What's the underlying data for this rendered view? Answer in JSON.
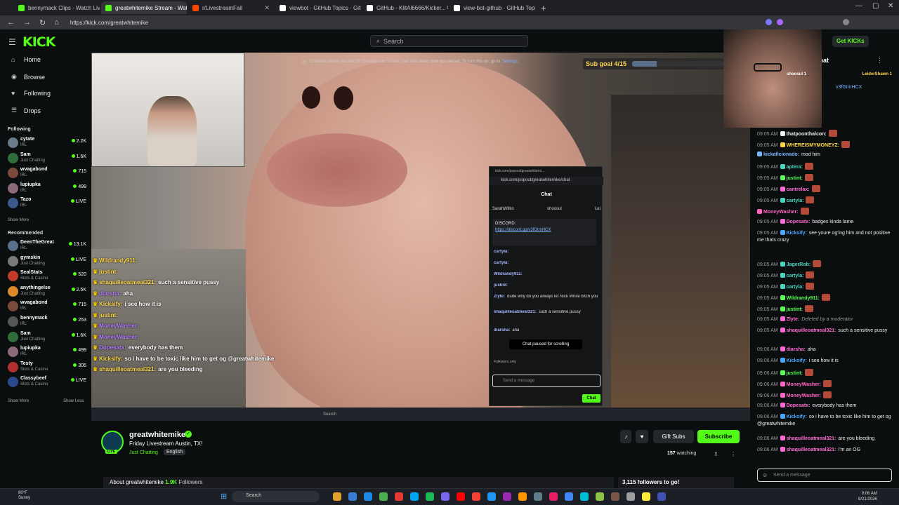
{
  "browser": {
    "tabs": [
      {
        "label": "bennymack Clips - Watch Liv",
        "color": "#53fc18"
      },
      {
        "label": "greatwhitemike Stream - Wat",
        "color": "#53fc18",
        "active": true
      },
      {
        "label": "r/LivestreamFail",
        "color": "#ff4500"
      },
      {
        "label": "viewbot · GitHub Topics · GitHub",
        "color": "#ffffff"
      },
      {
        "label": "GitHub - KlitAl6666/Kicker...",
        "color": "#ffffff"
      },
      {
        "label": "view-bot-github · GitHub Topics ·",
        "color": "#ffffff"
      }
    ],
    "url": "https://kick.com/greatwhitemike"
  },
  "header": {
    "logo": "KICK",
    "search_placeholder": "Search",
    "get_kicks": "Get KICKs"
  },
  "sidebar": {
    "nav": [
      {
        "icon": "⌂",
        "label": "Home"
      },
      {
        "icon": "◉",
        "label": "Browse"
      },
      {
        "icon": "♥",
        "label": "Following"
      },
      {
        "icon": "☰",
        "label": "Drops"
      }
    ],
    "following_title": "Following",
    "following": [
      {
        "name": "cytate",
        "category": "IRL",
        "viewers": "2.2K",
        "color": "#6a7b8c"
      },
      {
        "name": "Sam",
        "category": "Just Chatting",
        "viewers": "1.6K",
        "color": "#2f6e3b"
      },
      {
        "name": "wvagabond",
        "category": "IRL",
        "viewers": "715",
        "color": "#7a4a3a"
      },
      {
        "name": "lupiupka",
        "category": "IRL",
        "viewers": "499",
        "color": "#8c6a7a"
      },
      {
        "name": "Tazo",
        "category": "IRL",
        "viewers": "LIVE",
        "color": "#3a5a8c"
      }
    ],
    "show_more": "Show More",
    "recommended_title": "Recommended",
    "recommended": [
      {
        "name": "DeenTheGreat",
        "category": "IRL",
        "viewers": "13.1K",
        "color": "#5a6f8c"
      },
      {
        "name": "gymskin",
        "category": "Just Chatting",
        "viewers": "LIVE",
        "color": "#7a7a7a"
      },
      {
        "name": "SealStats",
        "category": "Slots & Casino",
        "viewers": "520",
        "color": "#c23a2a"
      },
      {
        "name": "anythingelse",
        "category": "Just Chatting",
        "viewers": "2.5K",
        "color": "#d98a2a"
      },
      {
        "name": "wvagabond",
        "category": "IRL",
        "viewers": "715",
        "color": "#7a4a3a"
      },
      {
        "name": "bennymack",
        "category": "IRL",
        "viewers": "253",
        "color": "#555555"
      },
      {
        "name": "Sam",
        "category": "Just Chatting",
        "viewers": "1.6K",
        "color": "#2f6e3b"
      },
      {
        "name": "lupiupka",
        "category": "IRL",
        "viewers": "499",
        "color": "#8c6a7a"
      },
      {
        "name": "Testy",
        "category": "Slots & Casino",
        "viewers": "305",
        "color": "#b03030"
      },
      {
        "name": "Classybeef",
        "category": "Slots & Casino",
        "viewers": "LIVE",
        "color": "#2a4a8c"
      }
    ],
    "show_more_2": "Show More",
    "show_less": "Show Less"
  },
  "video": {
    "restore_msg": "Continue where you left off: Chrome can restore your tabs every time you restart. To turn this on, go to",
    "restore_link": "Settings.",
    "sub_goal": "Sub goal 4/15",
    "sub_goal_progress": 0.27,
    "overlay_chat": [
      {
        "user": "Wildrandy911:",
        "msg": "",
        "style": "y"
      },
      {
        "user": "justint:",
        "msg": "",
        "style": "y"
      },
      {
        "user": "shaquilleoatmeal321:",
        "msg": "such a sensitive pussy",
        "style": "y"
      },
      {
        "user": "diarsha:",
        "msg": "aha",
        "style": "p"
      },
      {
        "user": "Kicksify:",
        "msg": "i see how it is",
        "style": "y"
      },
      {
        "user": "justint:",
        "msg": "",
        "style": "y"
      },
      {
        "user": "MoneyWasher:",
        "msg": "",
        "style": "p"
      },
      {
        "user": "MoneyWasher:",
        "msg": "",
        "style": "p"
      },
      {
        "user": "Dopesatx:",
        "msg": "everybody has them",
        "style": "p"
      },
      {
        "user": "Kicksify:",
        "msg": "so i have to be toxic like him to get og @greatwhitemike",
        "style": "y"
      },
      {
        "user": "shaquilleoatmeal321:",
        "msg": "are you bleeding",
        "style": "y"
      }
    ],
    "popout": {
      "title": "kick.com/popout/greatwhitemi...",
      "url": "kick.com/popout/greatwhitemike/chat",
      "header": "Chat",
      "top_gifters": [
        "SarahWilko",
        "shoosul",
        "Lei"
      ],
      "pinned_label": "DISCORD:",
      "pinned_link": "https://discord.gg/v3fGtmHCX",
      "lines": [
        {
          "user": "cartyla:",
          "msg": ""
        },
        {
          "user": "cartyla:",
          "msg": ""
        },
        {
          "user": "Wildrandy911:",
          "msg": ""
        },
        {
          "user": "justint:",
          "msg": ""
        },
        {
          "user": "Zlyte:",
          "msg": "dude why do you always let Nick White bitch you (Deleted)"
        },
        {
          "user": "shaquilleoatmeal321:",
          "msg": "such a sensitive pussy"
        },
        {
          "user": "diarsha:",
          "msg": "aha"
        }
      ],
      "paused": "Chat paused for scrolling",
      "followers_only": "Followers only",
      "input_placeholder": "Send a message",
      "chat_button": "Chat"
    }
  },
  "stream": {
    "name": "greatwhitemike",
    "title": "Friday Livestream Austin, TX!",
    "category": "Just Chatting",
    "language": "English",
    "live_badge": "LIVE",
    "gift_subs": "Gift Subs",
    "subscribe": "Subscribe",
    "watching_count": "157",
    "watching_label": "watching",
    "about": "About greatwhitemike",
    "followers": "1.9K",
    "followers_label": "Followers",
    "follow_goal": "3,115 followers to go!"
  },
  "chat": {
    "title": "Chat",
    "gifters": [
      "shoosul 1",
      "LeiderShawn 1"
    ],
    "pinned_link": "v3fGtmHCX",
    "messages": [
      {
        "time": "09:05 AM",
        "user": "thatpoonthalcon:",
        "color": "#f0f0f0",
        "msg": "",
        "emote": true
      },
      {
        "time": "09:05 AM",
        "user": "WHEREISMYMONEYZ:",
        "color": "#ffd84a",
        "msg": "",
        "emote": true
      },
      {
        "time": "",
        "user": "kickaficionado:",
        "color": "#7ab6ff",
        "msg": "mod him",
        "emote": false
      },
      {
        "time": "09:05 AM",
        "user": "aptera:",
        "color": "#4ad6c0",
        "msg": "",
        "emote": true
      },
      {
        "time": "09:05 AM",
        "user": "justint:",
        "color": "#5aff5a",
        "msg": "",
        "emote": true
      },
      {
        "time": "09:05 AM",
        "user": "cantrelax:",
        "color": "#ff6ad5",
        "msg": "",
        "emote": true
      },
      {
        "time": "09:05 AM",
        "user": "cartyla:",
        "color": "#4ad6c0",
        "msg": "",
        "emote": true
      },
      {
        "time": "",
        "user": "MoneyWasher:",
        "color": "#ff66c4",
        "msg": "",
        "emote": true
      },
      {
        "time": "09:05 AM",
        "user": "Dopesatx:",
        "color": "#ff6ad5",
        "msg": "badges kinda lame",
        "emote": false
      },
      {
        "time": "09:05 AM",
        "user": "Kicksify:",
        "color": "#4aa8ff",
        "msg": "see youre og'ing him and not positive me thats crazy",
        "emote": false
      },
      {
        "time": "",
        "user": "",
        "color": "#ffffff",
        "msg": "",
        "emote": false
      },
      {
        "time": "09:05 AM",
        "user": "JagerRob:",
        "color": "#4ad6c0",
        "msg": "",
        "emote": true
      },
      {
        "time": "09:05 AM",
        "user": "cartyla:",
        "color": "#4ad6c0",
        "msg": "",
        "emote": true
      },
      {
        "time": "09:05 AM",
        "user": "cartyla:",
        "color": "#4ad6c0",
        "msg": "",
        "emote": true
      },
      {
        "time": "09:05 AM",
        "user": "Wildrandy911:",
        "color": "#5aff5a",
        "msg": "",
        "emote": true
      },
      {
        "time": "09:05 AM",
        "user": "justint:",
        "color": "#5aff5a",
        "msg": "",
        "emote": true
      },
      {
        "time": "09:05 AM",
        "user": "Zlyte:",
        "color": "#ff6ad5",
        "msg": "Deleted by a moderator",
        "emote": false,
        "deleted": true
      },
      {
        "time": "09:05 AM",
        "user": "shaquilleoatmeal321:",
        "color": "#ff6ad5",
        "msg": "such a sensitive pussy",
        "emote": false
      },
      {
        "time": "",
        "user": "",
        "color": "#ffffff",
        "msg": "",
        "emote": false
      },
      {
        "time": "09:06 AM",
        "user": "diarsha:",
        "color": "#ff6ad5",
        "msg": "aha",
        "emote": false
      },
      {
        "time": "09:06 AM",
        "user": "Kicksify:",
        "color": "#4aa8ff",
        "msg": "i see how it is",
        "emote": false
      },
      {
        "time": "09:06 AM",
        "user": "justint:",
        "color": "#5aff5a",
        "msg": "",
        "emote": true
      },
      {
        "time": "09:06 AM",
        "user": "MoneyWasher:",
        "color": "#ff66c4",
        "msg": "",
        "emote": true
      },
      {
        "time": "09:06 AM",
        "user": "MoneyWasher:",
        "color": "#ff66c4",
        "msg": "",
        "emote": true
      },
      {
        "time": "09:06 AM",
        "user": "Dopesatx:",
        "color": "#ff6ad5",
        "msg": "everybody has them",
        "emote": false
      },
      {
        "time": "09:06 AM",
        "user": "Kicksify:",
        "color": "#4aa8ff",
        "msg": "so i have to be toxic like him to get og @greatwhitemike",
        "emote": false
      },
      {
        "time": "",
        "user": "",
        "color": "#ffffff",
        "msg": "",
        "emote": false
      },
      {
        "time": "09:06 AM",
        "user": "shaquilleoatmeal321:",
        "color": "#ff6ad5",
        "msg": "are you bleeding",
        "emote": false
      },
      {
        "time": "09:06 AM",
        "user": "shaquilleoatmeal321:",
        "color": "#ff6ad5",
        "msg": "I'm an OG",
        "emote": false
      }
    ],
    "input_placeholder": "Send a message"
  },
  "taskbar": {
    "weather_temp": "80°F",
    "weather_desc": "Sunny",
    "search": "Search",
    "time": "9:06 AM",
    "date": "8/21/2026"
  },
  "colors": {
    "accent": "#53fc18",
    "bg": "#0b0e0f"
  }
}
